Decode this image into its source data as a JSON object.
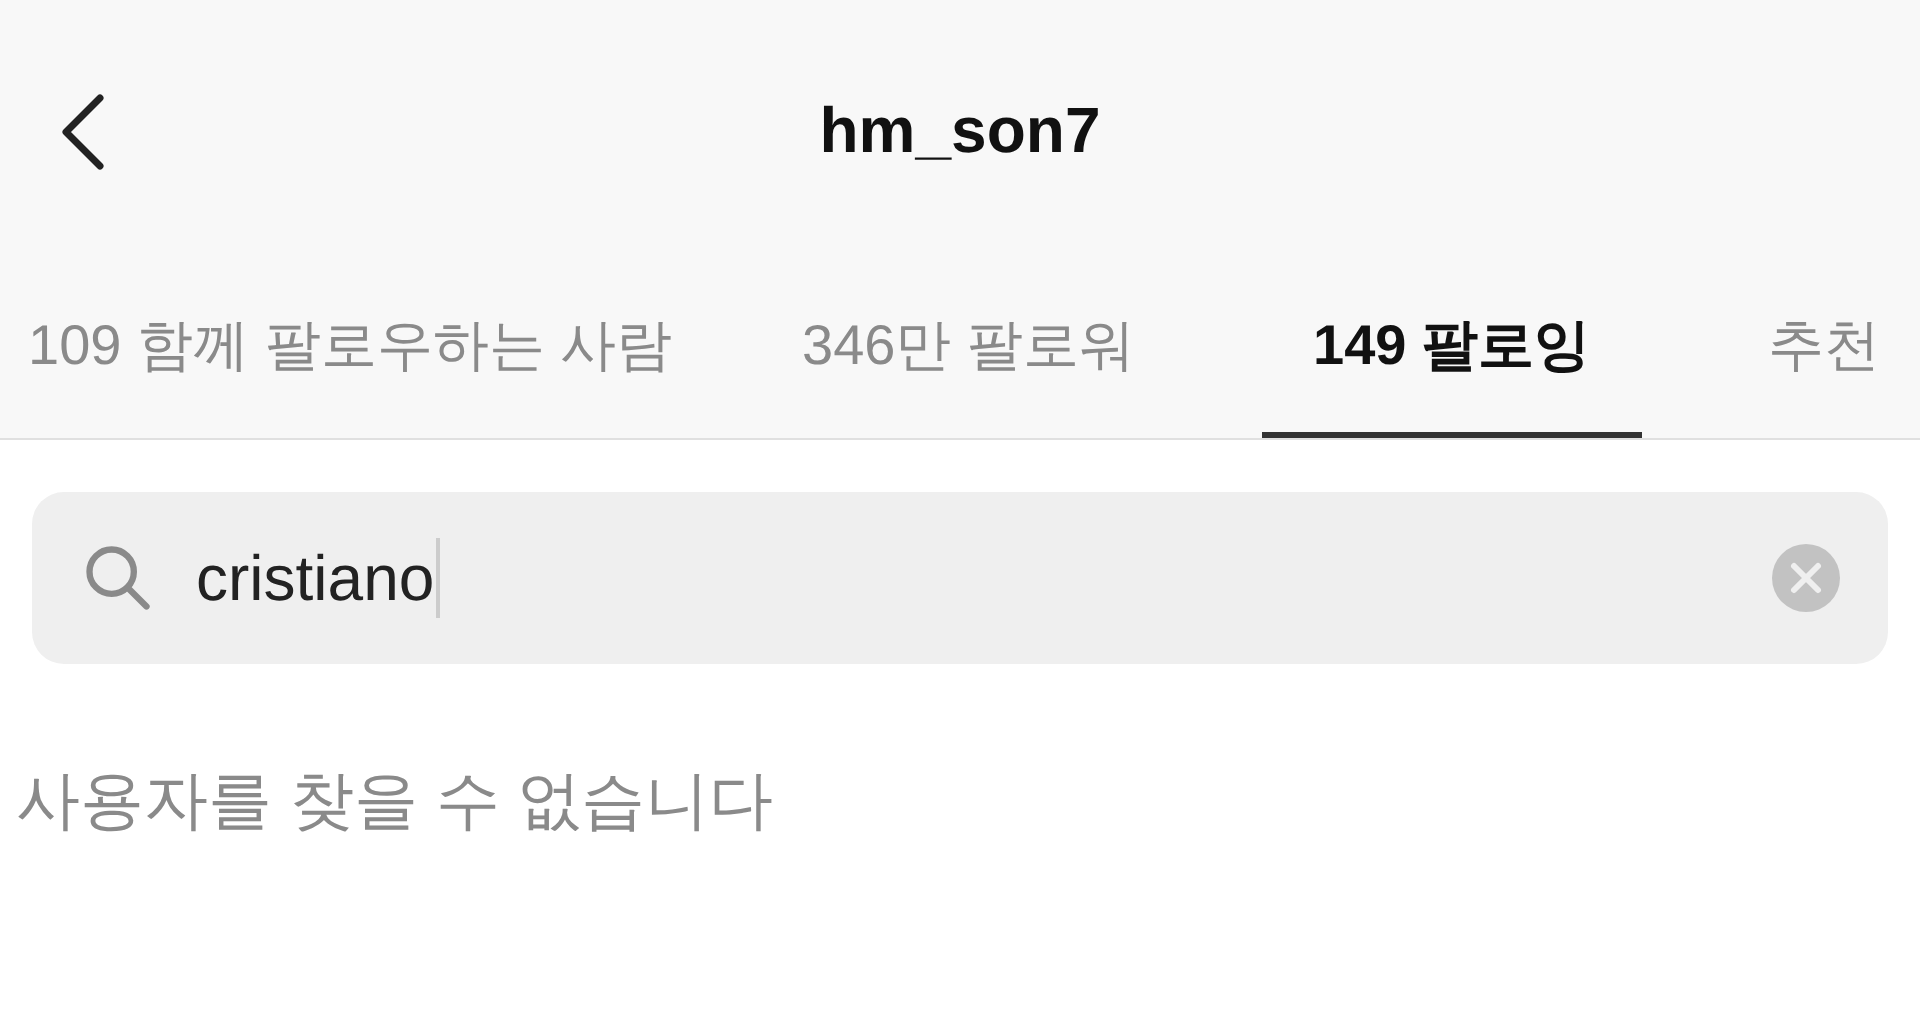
{
  "header": {
    "title": "hm_son7"
  },
  "tabs": [
    {
      "label": "109 함께 팔로우하는 사람",
      "selected": false
    },
    {
      "label": "346만 팔로워",
      "selected": false
    },
    {
      "label": "149 팔로잉",
      "selected": true
    },
    {
      "label": "추천",
      "selected": false
    }
  ],
  "search": {
    "value": "cristiano"
  },
  "message": "사용자를 찾을 수 없습니다"
}
